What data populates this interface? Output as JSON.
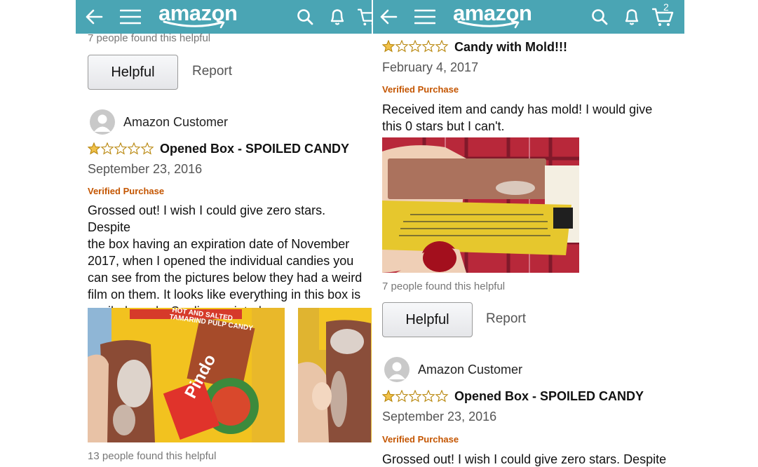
{
  "header": {
    "logo_text": "amazon",
    "cart_count": "2"
  },
  "left": {
    "prev_helpful_count": "7 people found this helpful",
    "helpful_label": "Helpful",
    "report_label": "Report",
    "review": {
      "reviewer": "Amazon Customer",
      "rating": 1,
      "title": "Opened Box - SPOILED CANDY",
      "date": "September 23, 2016",
      "verified": "Verified Purchase",
      "body_lines": [
        "Grossed out! I wish I could give zero stars. Despite",
        "the box having an expiration date of November",
        "2017, when I opened the individual candies you",
        "can see from the pictures below they had a weird",
        "film on them. It looks like everything in this box is",
        "spoiled candy. So disappointed."
      ],
      "photo1_text": {
        "top": "HOT AND SALTED",
        "mid": "TAMARIND PULP CANDY",
        "brand": "Pindo"
      },
      "helpful_count": "13 people found this helpful"
    }
  },
  "right": {
    "review1": {
      "rating": 1,
      "title": "Candy with Mold!!!",
      "date": "February 4, 2017",
      "verified": "Verified Purchase",
      "body_lines": [
        "Received item and candy has mold! I would give",
        "this 0 stars but I can't."
      ],
      "helpful_count": "7 people found this helpful"
    },
    "helpful_label": "Helpful",
    "report_label": "Report",
    "review2": {
      "reviewer": "Amazon Customer",
      "rating": 1,
      "title": "Opened Box - SPOILED CANDY",
      "date": "September 23, 2016",
      "verified": "Verified Purchase",
      "body_first_line": "Grossed out! I wish I could give zero stars. Despite"
    }
  },
  "colors": {
    "header_bg": "#4aa5b4",
    "verified": "#c45500",
    "star": "#f0c14b"
  }
}
